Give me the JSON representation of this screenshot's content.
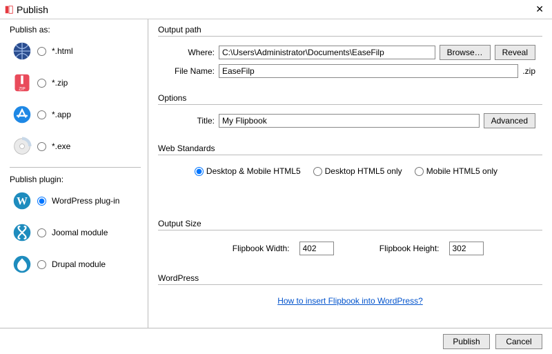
{
  "window": {
    "title": "Publish"
  },
  "sidebar": {
    "publish_as_label": "Publish as:",
    "publish_as": [
      {
        "id": "html",
        "label": "*.html",
        "checked": false
      },
      {
        "id": "zip",
        "label": "*.zip",
        "checked": false
      },
      {
        "id": "app",
        "label": "*.app",
        "checked": false
      },
      {
        "id": "exe",
        "label": "*.exe",
        "checked": false
      }
    ],
    "publish_plugin_label": "Publish plugin:",
    "publish_plugin": [
      {
        "id": "wp",
        "label": "WordPress plug-in",
        "checked": true
      },
      {
        "id": "joomla",
        "label": "Joomal module",
        "checked": false
      },
      {
        "id": "drupal",
        "label": "Drupal module",
        "checked": false
      }
    ]
  },
  "output_path": {
    "legend": "Output path",
    "where_label": "Where:",
    "where_value": "C:\\Users\\Administrator\\Documents\\EaseFilp",
    "browse_label": "Browse…",
    "reveal_label": "Reveal",
    "filename_label": "File Name:",
    "filename_value": "EaseFilp",
    "ext": ".zip"
  },
  "options": {
    "legend": "Options",
    "title_label": "Title:",
    "title_value": "My Flipbook",
    "advanced_label": "Advanced"
  },
  "web_standards": {
    "legend": "Web Standards",
    "opts": [
      {
        "label": "Desktop & Mobile HTML5",
        "checked": true
      },
      {
        "label": "Desktop HTML5 only",
        "checked": false
      },
      {
        "label": "Mobile HTML5 only",
        "checked": false
      }
    ]
  },
  "output_size": {
    "legend": "Output Size",
    "width_label": "Flipbook Width:",
    "width_value": "402",
    "height_label": "Flipbook Height:",
    "height_value": "302"
  },
  "wordpress": {
    "legend": "WordPress",
    "link_text": "How to insert Flipbook into WordPress?"
  },
  "footer": {
    "publish": "Publish",
    "cancel": "Cancel"
  }
}
